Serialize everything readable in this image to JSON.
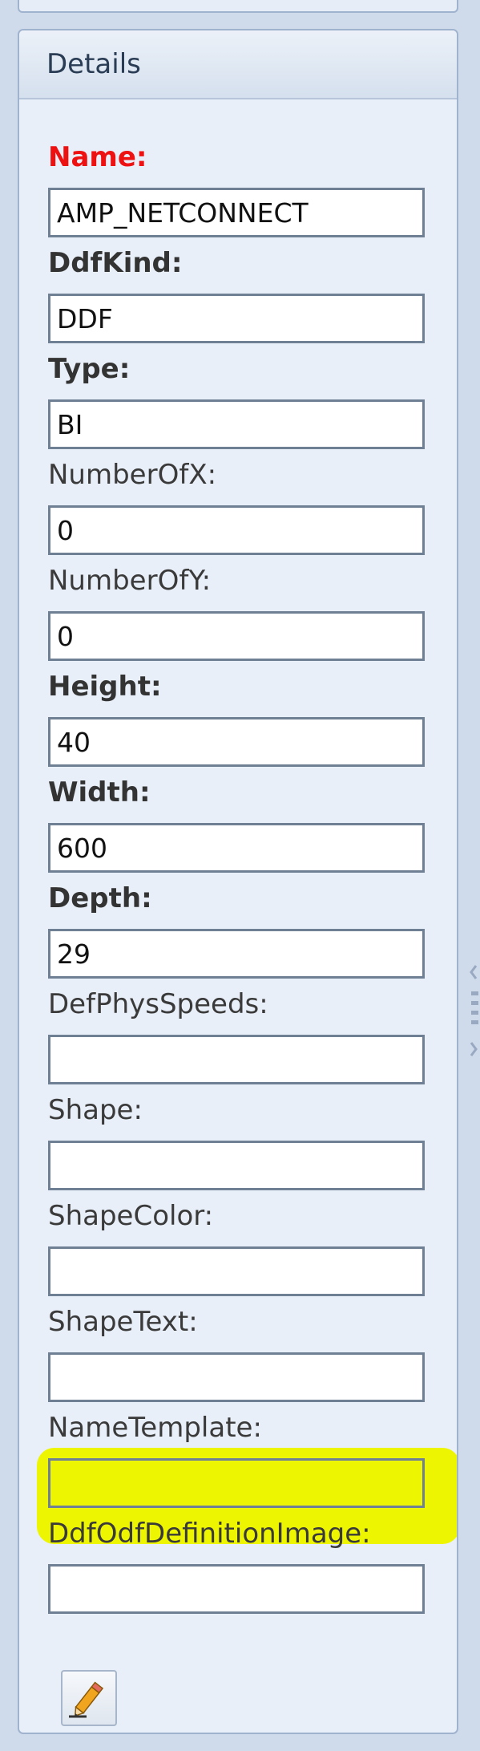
{
  "panel": {
    "title": "Details"
  },
  "fields": [
    {
      "label": "Name:",
      "value": "AMP_NETCONNECT",
      "style": "required"
    },
    {
      "label": "DdfKind:",
      "value": "DDF",
      "style": "bold"
    },
    {
      "label": "Type:",
      "value": "BI",
      "style": "bold"
    },
    {
      "label": "NumberOfX:",
      "value": "0",
      "style": "normal"
    },
    {
      "label": "NumberOfY:",
      "value": "0",
      "style": "normal"
    },
    {
      "label": "Height:",
      "value": "40",
      "style": "bold"
    },
    {
      "label": "Width:",
      "value": "600",
      "style": "bold"
    },
    {
      "label": "Depth:",
      "value": "29",
      "style": "bold"
    },
    {
      "label": "DefPhysSpeeds:",
      "value": "",
      "style": "normal"
    },
    {
      "label": "Shape:",
      "value": "",
      "style": "normal"
    },
    {
      "label": "ShapeColor:",
      "value": "",
      "style": "normal"
    },
    {
      "label": "ShapeText:",
      "value": "",
      "style": "normal"
    },
    {
      "label": "NameTemplate:",
      "value": "",
      "style": "normal",
      "highlighted": true
    },
    {
      "label": "DdfOdfDefinitionImage:",
      "value": "",
      "style": "normal"
    }
  ],
  "colors": {
    "required_label": "#ee1111",
    "highlight": "#eef500"
  },
  "icons": {
    "edit": "pencil-icon"
  }
}
